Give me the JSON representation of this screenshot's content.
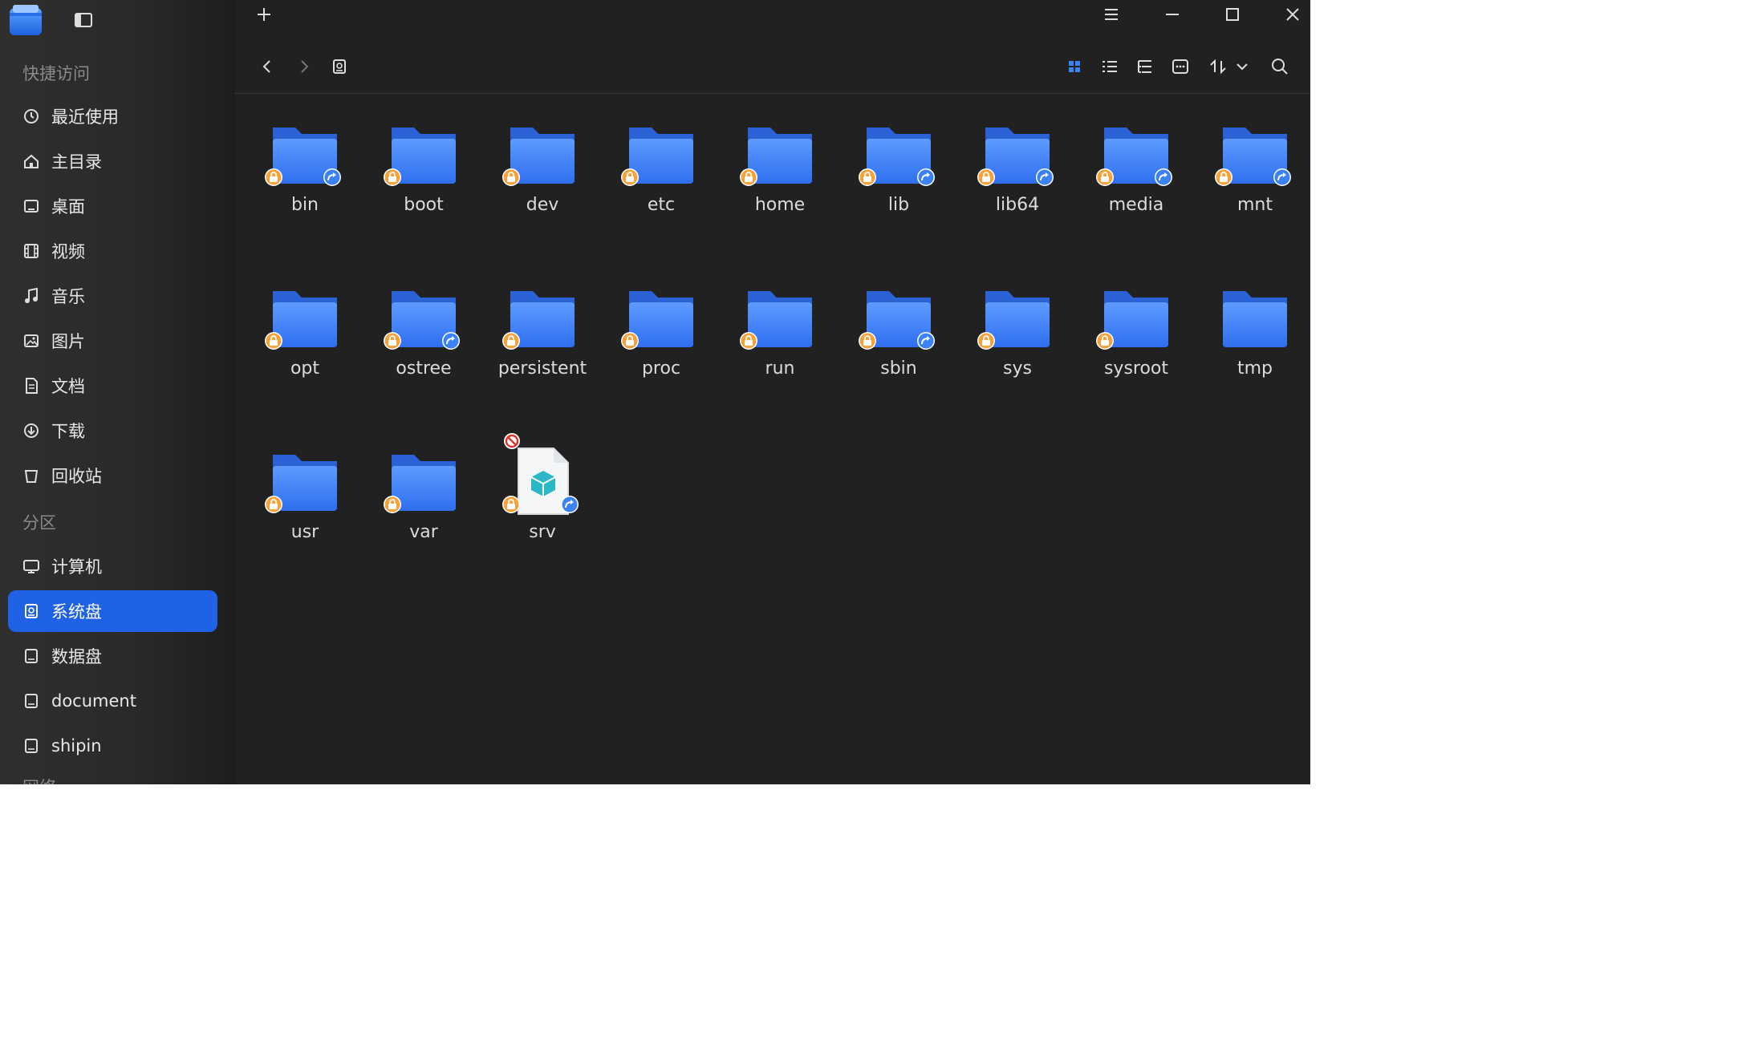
{
  "sidebar": {
    "quick_access_title": "快捷访问",
    "quick_access": [
      {
        "label": "最近使用",
        "icon": "clock-icon"
      },
      {
        "label": "主目录",
        "icon": "home-icon"
      },
      {
        "label": "桌面",
        "icon": "desktop-icon"
      },
      {
        "label": "视频",
        "icon": "video-icon"
      },
      {
        "label": "音乐",
        "icon": "music-icon"
      },
      {
        "label": "图片",
        "icon": "image-icon"
      },
      {
        "label": "文档",
        "icon": "document-icon"
      },
      {
        "label": "下载",
        "icon": "download-icon"
      },
      {
        "label": "回收站",
        "icon": "trash-icon"
      }
    ],
    "partitions_title": "分区",
    "partitions": [
      {
        "label": "计算机",
        "icon": "computer-icon"
      },
      {
        "label": "系统盘",
        "icon": "system-disk-icon",
        "active": true
      },
      {
        "label": "数据盘",
        "icon": "disk-icon"
      },
      {
        "label": "document",
        "icon": "disk-icon"
      },
      {
        "label": "shipin",
        "icon": "disk-icon"
      }
    ],
    "next_section_title": "网络"
  },
  "colors": {
    "accent": "#1f62e6",
    "folder": "#3b82f6",
    "lock_emblem": "#f5a23a",
    "link_emblem": "#3b82f6"
  },
  "files": [
    {
      "name": "bin",
      "type": "folder",
      "lock": true,
      "link": true
    },
    {
      "name": "boot",
      "type": "folder",
      "lock": true,
      "link": false
    },
    {
      "name": "dev",
      "type": "folder",
      "lock": true,
      "link": false
    },
    {
      "name": "etc",
      "type": "folder",
      "lock": true,
      "link": false
    },
    {
      "name": "home",
      "type": "folder",
      "lock": true,
      "link": false
    },
    {
      "name": "lib",
      "type": "folder",
      "lock": true,
      "link": true
    },
    {
      "name": "lib64",
      "type": "folder",
      "lock": true,
      "link": true
    },
    {
      "name": "media",
      "type": "folder",
      "lock": true,
      "link": true
    },
    {
      "name": "mnt",
      "type": "folder",
      "lock": true,
      "link": true
    },
    {
      "name": "opt",
      "type": "folder",
      "lock": true,
      "link": false
    },
    {
      "name": "ostree",
      "type": "folder",
      "lock": true,
      "link": true
    },
    {
      "name": "persistent",
      "type": "folder",
      "lock": true,
      "link": false
    },
    {
      "name": "proc",
      "type": "folder",
      "lock": true,
      "link": false
    },
    {
      "name": "run",
      "type": "folder",
      "lock": true,
      "link": false
    },
    {
      "name": "sbin",
      "type": "folder",
      "lock": true,
      "link": true
    },
    {
      "name": "sys",
      "type": "folder",
      "lock": true,
      "link": false
    },
    {
      "name": "sysroot",
      "type": "folder",
      "lock": true,
      "link": false
    },
    {
      "name": "tmp",
      "type": "folder",
      "lock": false,
      "link": false
    },
    {
      "name": "usr",
      "type": "folder",
      "lock": true,
      "link": false
    },
    {
      "name": "var",
      "type": "folder",
      "lock": true,
      "link": false
    },
    {
      "name": "srv",
      "type": "broken-link",
      "lock": true,
      "link": true,
      "blocked": true
    }
  ]
}
